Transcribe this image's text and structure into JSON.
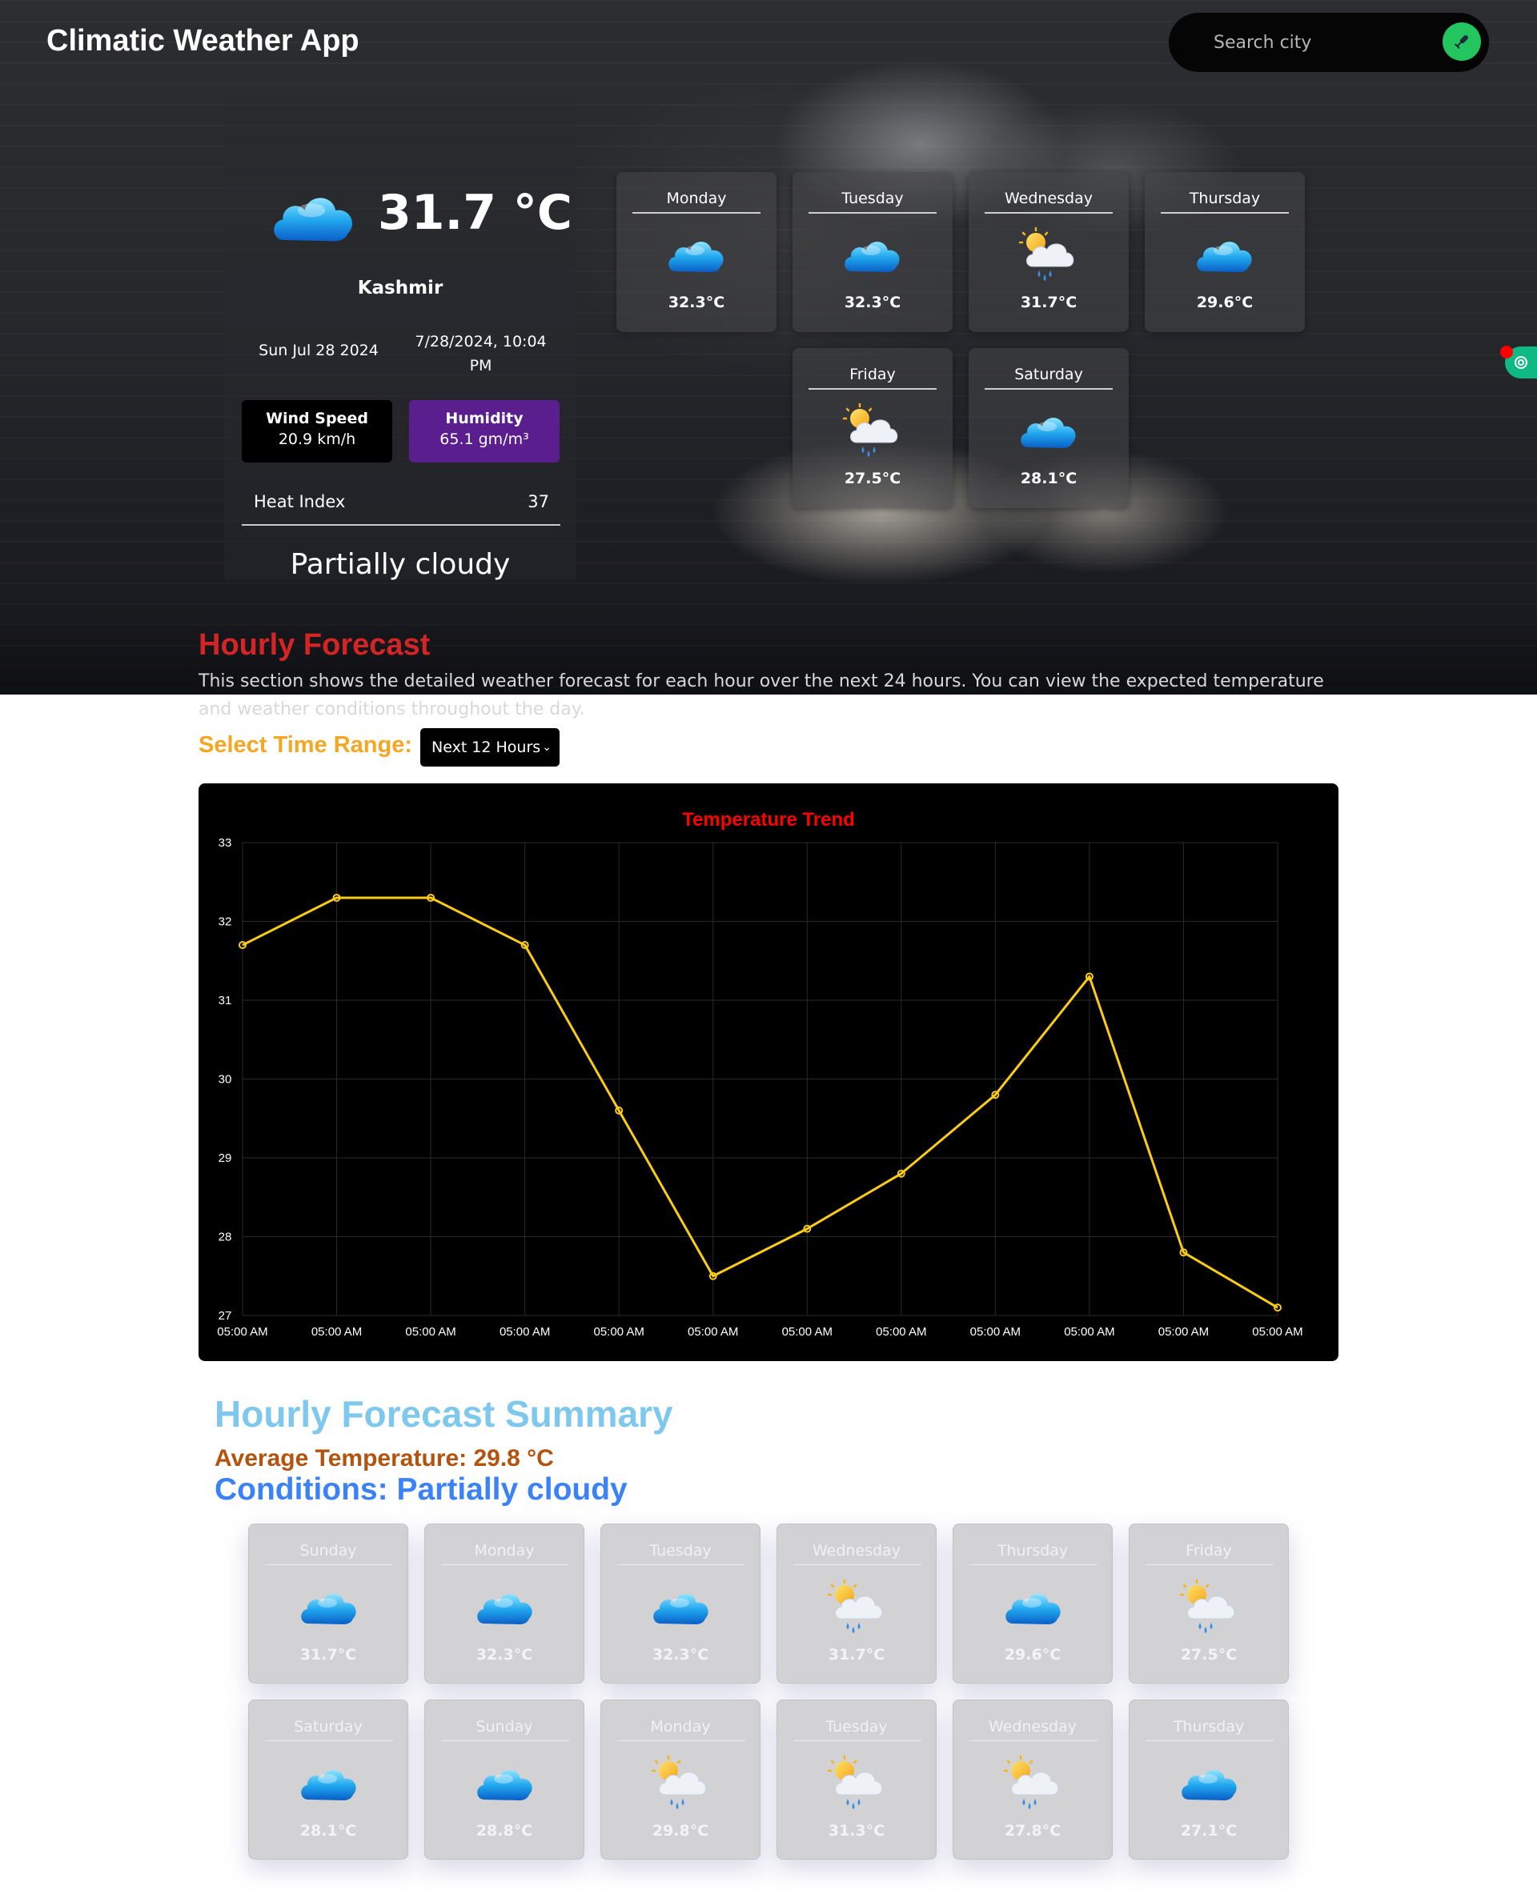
{
  "header": {
    "app_title": "Climatic Weather App",
    "search_placeholder": "Search city",
    "search_icon": "mic-icon"
  },
  "current": {
    "icon": "cloud-icon",
    "temperature": "31.7 °C",
    "location": "Kashmir",
    "date": "Sun Jul 28 2024",
    "datetime": "7/28/2024, 10:04 PM",
    "wind_label": "Wind Speed",
    "wind_value": "20.9 km/h",
    "humidity_label": "Humidity",
    "humidity_value": "65.1 gm/m³",
    "heat_index_label": "Heat Index",
    "heat_index_value": "37",
    "condition": "Partially cloudy"
  },
  "weekly_forecast": [
    {
      "day": "Monday",
      "temp": "32.3°C",
      "icon": "cloud"
    },
    {
      "day": "Tuesday",
      "temp": "32.3°C",
      "icon": "cloud"
    },
    {
      "day": "Wednesday",
      "temp": "31.7°C",
      "icon": "sun-rain"
    },
    {
      "day": "Thursday",
      "temp": "29.6°C",
      "icon": "cloud"
    },
    {
      "day": "Friday",
      "temp": "27.5°C",
      "icon": "sun-rain"
    },
    {
      "day": "Saturday",
      "temp": "28.1°C",
      "icon": "cloud"
    }
  ],
  "hourly": {
    "title": "Hourly Forecast",
    "description": "This section shows the detailed weather forecast for each hour over the next 24 hours. You can view the expected temperature and weather conditions throughout the day.",
    "range_label": "Select Time Range:",
    "range_selected": "Next 12 Hours"
  },
  "chart_data": {
    "type": "line",
    "title": "Temperature Trend",
    "x": [
      "05:00 AM",
      "05:00 AM",
      "05:00 AM",
      "05:00 AM",
      "05:00 AM",
      "05:00 AM",
      "05:00 AM",
      "05:00 AM",
      "05:00 AM",
      "05:00 AM",
      "05:00 AM",
      "05:00 AM"
    ],
    "values": [
      31.7,
      32.3,
      32.3,
      31.7,
      29.6,
      27.5,
      28.1,
      28.8,
      29.8,
      31.3,
      27.8,
      27.1
    ],
    "ylim": [
      27,
      33
    ],
    "yticks": [
      "33",
      "32",
      "31",
      "30",
      "29",
      "28",
      "27"
    ],
    "grid": true,
    "colors": {
      "line": "#facc15",
      "title": "#ff0000",
      "background": "#000000"
    }
  },
  "summary": {
    "title": "Hourly Forecast Summary",
    "average": "Average Temperature: 29.8 °C",
    "conditions": "Conditions: Partially cloudy"
  },
  "summary_forecast": [
    {
      "day": "Sunday",
      "temp": "31.7°C",
      "icon": "cloud"
    },
    {
      "day": "Monday",
      "temp": "32.3°C",
      "icon": "cloud"
    },
    {
      "day": "Tuesday",
      "temp": "32.3°C",
      "icon": "cloud"
    },
    {
      "day": "Wednesday",
      "temp": "31.7°C",
      "icon": "sun-rain"
    },
    {
      "day": "Thursday",
      "temp": "29.6°C",
      "icon": "cloud"
    },
    {
      "day": "Friday",
      "temp": "27.5°C",
      "icon": "sun-rain"
    },
    {
      "day": "Saturday",
      "temp": "28.1°C",
      "icon": "cloud"
    },
    {
      "day": "Sunday",
      "temp": "28.8°C",
      "icon": "cloud"
    },
    {
      "day": "Monday",
      "temp": "29.8°C",
      "icon": "sun-rain"
    },
    {
      "day": "Tuesday",
      "temp": "31.3°C",
      "icon": "sun-rain"
    },
    {
      "day": "Wednesday",
      "temp": "27.8°C",
      "icon": "sun-rain"
    },
    {
      "day": "Thursday",
      "temp": "27.1°C",
      "icon": "cloud"
    }
  ]
}
